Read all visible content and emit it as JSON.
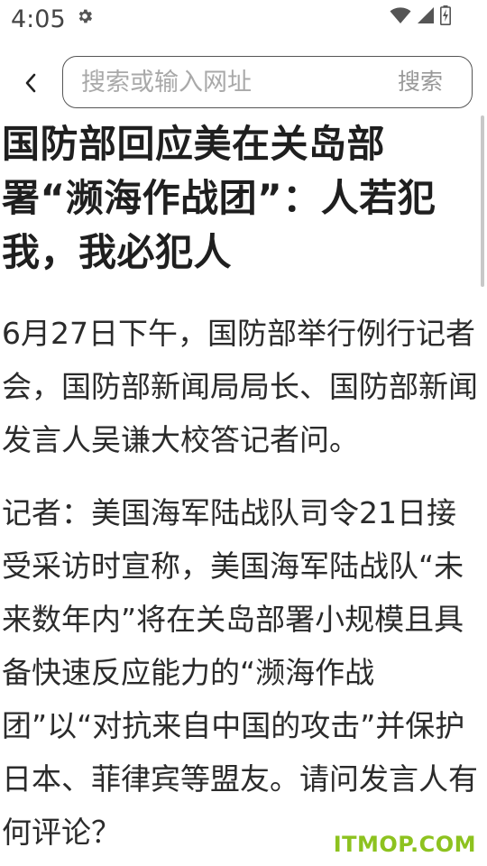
{
  "status_bar": {
    "time": "4:05",
    "icons": [
      "gear-icon",
      "wifi-icon",
      "signal-icon",
      "battery-charging-icon"
    ]
  },
  "search": {
    "placeholder": "搜索或输入网址",
    "value": "",
    "button_label": "搜索"
  },
  "article": {
    "title": "国防部回应美在关岛部署“濒海作战团”：人若犯我，我必犯人",
    "paragraphs": [
      "6月27日下午，国防部举行例行记者会，国防部新闻局局长、国防部新闻发言人吴谦大校答记者问。",
      "记者：美国海军陆战队司令21日接受采访时宣称，美国海军陆战队“未来数年内”将在关岛部署小规模且具备快速反应能力的“濒海作战团”以“对抗来自中国的攻击”并保护日本、菲律宾等盟友。请问发言人有何评论？"
    ]
  },
  "watermark": "ITMOP.COM",
  "colors": {
    "watermark": "#8dc21f",
    "search_border": "#555555",
    "placeholder": "#a9a9a9"
  }
}
